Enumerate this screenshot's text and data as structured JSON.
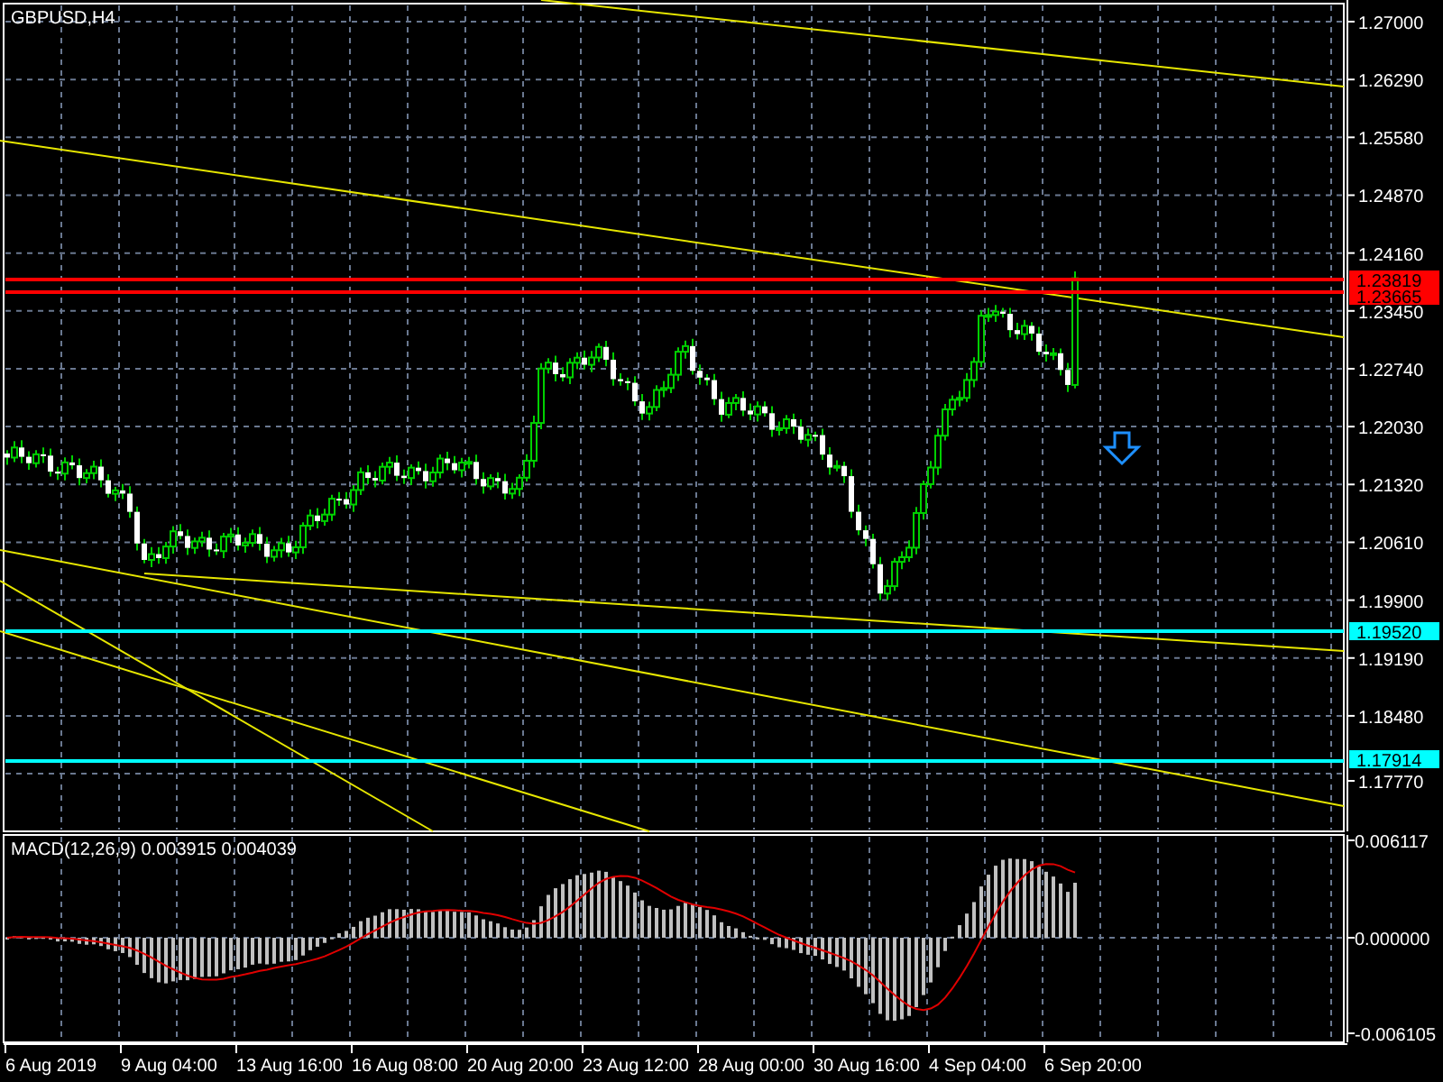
{
  "chart": {
    "symbol_label": "GBPUSD,H4",
    "price_axis": [
      "1.27000",
      "1.26290",
      "1.25580",
      "1.24870",
      "1.24160",
      "1.23450",
      "1.22740",
      "1.22030",
      "1.21320",
      "1.20610",
      "1.19900",
      "1.19190",
      "1.18480",
      "1.17770"
    ],
    "price_tags": [
      {
        "text": "1.23819",
        "color": "#ff0000"
      },
      {
        "text": "1.23665",
        "color": "#ff0000"
      },
      {
        "text": "1.19520",
        "color": "#00ffff"
      },
      {
        "text": "1.17914",
        "color": "#00ffff"
      }
    ],
    "time_axis": [
      "6 Aug 2019",
      "9 Aug 04:00",
      "13 Aug 16:00",
      "16 Aug 08:00",
      "20 Aug 20:00",
      "23 Aug 12:00",
      "28 Aug 00:00",
      "30 Aug 16:00",
      "4 Sep 04:00",
      "6 Sep 20:00"
    ]
  },
  "macd": {
    "label": "MACD(12,26,9) 0.003915 0.004039",
    "axis": [
      "0.006117",
      "0.000000",
      "-0.006105"
    ]
  }
}
